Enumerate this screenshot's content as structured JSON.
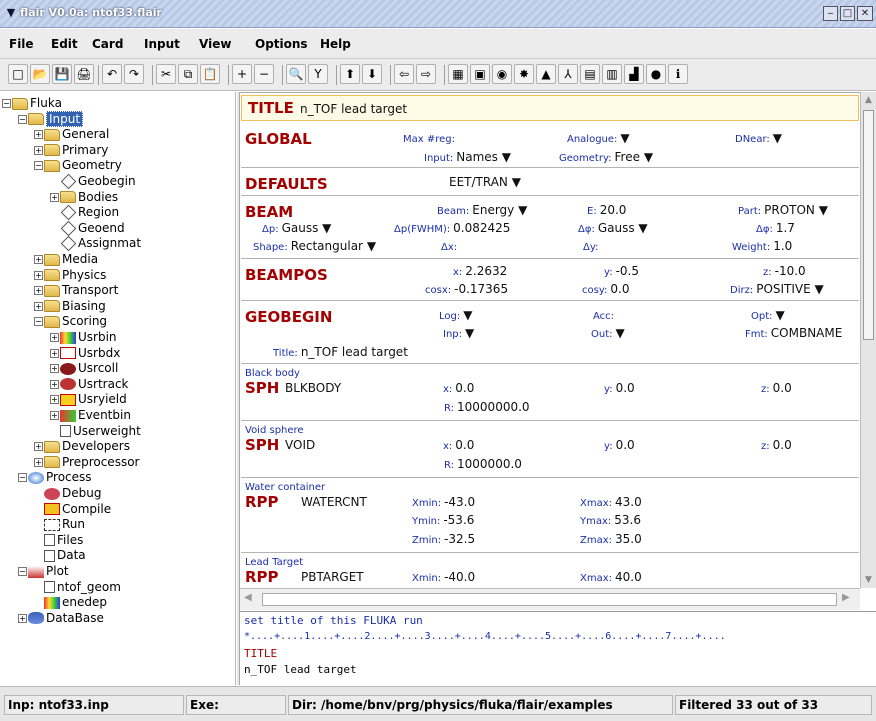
{
  "window": {
    "title": "flair V0.0a: ntof33.flair",
    "controls": [
      "minimize-icon",
      "maximize-icon",
      "close-icon"
    ]
  },
  "menu": [
    "File",
    "Edit",
    "Card",
    "Input",
    "View",
    "Options",
    "Help"
  ],
  "toolbar": {
    "icons": [
      "new-icon",
      "open-icon",
      "save-icon",
      "print-icon",
      "undo-icon",
      "redo-icon",
      "cut-icon",
      "copy-icon",
      "paste-icon",
      "add-icon",
      "remove-icon",
      "find-icon",
      "filter-icon",
      "move-up-icon",
      "move-down-icon",
      "indent-left-icon",
      "indent-right-icon",
      "run-icon",
      "geometry-icon",
      "process-icon",
      "plot-icon",
      "compile-icon",
      "files-icon",
      "data-icon",
      "view-icon",
      "plot2-icon",
      "database-icon",
      "info-icon"
    ],
    "glyphs": [
      "□",
      "📂",
      "💾",
      "🖨",
      "↶",
      "↷",
      "✂",
      "⧉",
      "📋",
      "+",
      "−",
      "🔍",
      "Y",
      "⬆",
      "⬇",
      "⇦",
      "⇨",
      "▦",
      "▣",
      "◉",
      "✸",
      "▲",
      "⅄",
      "▤",
      "▥",
      "▟",
      "●",
      "ℹ"
    ]
  },
  "tree": [
    {
      "label": "Fluka",
      "level": 0,
      "exp": "−",
      "icon": "folder"
    },
    {
      "label": "Input",
      "level": 1,
      "exp": "−",
      "icon": "folder",
      "selected": true
    },
    {
      "label": "General",
      "level": 2,
      "exp": "+",
      "icon": "folder"
    },
    {
      "label": "Primary",
      "level": 2,
      "exp": "+",
      "icon": "folder"
    },
    {
      "label": "Geometry",
      "level": 2,
      "exp": "−",
      "icon": "folder"
    },
    {
      "label": "Geobegin",
      "level": 3,
      "exp": "",
      "icon": "diamond"
    },
    {
      "label": "Bodies",
      "level": 3,
      "exp": "+",
      "icon": "folder"
    },
    {
      "label": "Region",
      "level": 3,
      "exp": "",
      "icon": "diamond"
    },
    {
      "label": "Geoend",
      "level": 3,
      "exp": "",
      "icon": "diamond"
    },
    {
      "label": "Assignmat",
      "level": 3,
      "exp": "",
      "icon": "diamond"
    },
    {
      "label": "Media",
      "level": 2,
      "exp": "+",
      "icon": "folder"
    },
    {
      "label": "Physics",
      "level": 2,
      "exp": "+",
      "icon": "folder"
    },
    {
      "label": "Transport",
      "level": 2,
      "exp": "+",
      "icon": "folder"
    },
    {
      "label": "Biasing",
      "level": 2,
      "exp": "+",
      "icon": "folder"
    },
    {
      "label": "Scoring",
      "level": 2,
      "exp": "−",
      "icon": "folder"
    },
    {
      "label": "Usrbin",
      "level": 3,
      "exp": "+",
      "icon": "usrbin"
    },
    {
      "label": "Usrbdx",
      "level": 3,
      "exp": "+",
      "icon": "usrbdx"
    },
    {
      "label": "Usrcoll",
      "level": 3,
      "exp": "+",
      "icon": "usrcoll"
    },
    {
      "label": "Usrtrack",
      "level": 3,
      "exp": "+",
      "icon": "usrtrack"
    },
    {
      "label": "Usryield",
      "level": 3,
      "exp": "+",
      "icon": "usryield"
    },
    {
      "label": "Eventbin",
      "level": 3,
      "exp": "+",
      "icon": "eventbin"
    },
    {
      "label": "Userweight",
      "level": 3,
      "exp": "",
      "icon": "doc"
    },
    {
      "label": "Developers",
      "level": 2,
      "exp": "+",
      "icon": "folder"
    },
    {
      "label": "Preprocessor",
      "level": 2,
      "exp": "+",
      "icon": "folder"
    },
    {
      "label": "Process",
      "level": 1,
      "exp": "−",
      "icon": "process"
    },
    {
      "label": "Debug",
      "level": 2,
      "exp": "",
      "icon": "debug"
    },
    {
      "label": "Compile",
      "level": 2,
      "exp": "",
      "icon": "compile"
    },
    {
      "label": "Run",
      "level": 2,
      "exp": "",
      "icon": "run"
    },
    {
      "label": "Files",
      "level": 2,
      "exp": "",
      "icon": "doc"
    },
    {
      "label": "Data",
      "level": 2,
      "exp": "",
      "icon": "doc"
    },
    {
      "label": "Plot",
      "level": 1,
      "exp": "−",
      "icon": "plot"
    },
    {
      "label": "ntof_geom",
      "level": 2,
      "exp": "",
      "icon": "doc"
    },
    {
      "label": "enedep",
      "level": 2,
      "exp": "",
      "icon": "usrbin"
    },
    {
      "label": "DataBase",
      "level": 1,
      "exp": "+",
      "icon": "database"
    }
  ],
  "cards": {
    "title": {
      "name": "TITLE",
      "value": "n_TOF lead target"
    },
    "global": {
      "name": "GLOBAL",
      "maxreg_label": "Max #reg:",
      "analogue_label": "Analogue:",
      "dnear_label": "DNear:",
      "input_label": "Input:",
      "input_value": "Names",
      "geometry_label": "Geometry:",
      "geometry_value": "Free"
    },
    "defaults": {
      "name": "DEFAULTS",
      "value": "EET/TRAN"
    },
    "beam": {
      "name": "BEAM",
      "beam_label": "Beam:",
      "beam_value": "Energy",
      "e_label": "E:",
      "e_value": "20.0",
      "part_label": "Part:",
      "part_value": "PROTON",
      "dp_label": "Δp:",
      "dp_value": "Gauss",
      "dpfwhm_label": "Δp(FWHM):",
      "dpfwhm_value": "0.082425",
      "dphi_label": "Δφ:",
      "dphi_value": "Gauss",
      "dphi2_label": "Δφ:",
      "dphi2_value": "1.7",
      "shape_label": "Shape:",
      "shape_value": "Rectangular",
      "dx_label": "Δx:",
      "dy_label": "Δy:",
      "weight_label": "Weight:",
      "weight_value": "1.0"
    },
    "beampos": {
      "name": "BEAMPOS",
      "x_label": "x:",
      "x_value": "2.2632",
      "y_label": "y:",
      "y_value": "-0.5",
      "z_label": "z:",
      "z_value": "-10.0",
      "cosx_label": "cosx:",
      "cosx_value": "-0.17365",
      "cosy_label": "cosy:",
      "cosy_value": "0.0",
      "dirz_label": "Dirz:",
      "dirz_value": "POSITIVE"
    },
    "geobegin": {
      "name": "GEOBEGIN",
      "log_label": "Log:",
      "acc_label": "Acc:",
      "opt_label": "Opt:",
      "inp_label": "Inp:",
      "out_label": "Out:",
      "fmt_label": "Fmt:",
      "fmt_value": "COMBNAME",
      "title_label": "Title:",
      "title_value": "n_TOF lead target"
    },
    "sph1": {
      "comment": "Black body",
      "name": "SPH",
      "id": "BLKBODY",
      "x_label": "x:",
      "x_value": "0.0",
      "y_label": "y:",
      "y_value": "0.0",
      "z_label": "z:",
      "z_value": "0.0",
      "r_label": "R:",
      "r_value": "10000000.0"
    },
    "sph2": {
      "comment": "Void sphere",
      "name": "SPH",
      "id": "VOID",
      "x_label": "x:",
      "x_value": "0.0",
      "y_label": "y:",
      "y_value": "0.0",
      "z_label": "z:",
      "z_value": "0.0",
      "r_label": "R:",
      "r_value": "1000000.0"
    },
    "rpp1": {
      "comment": "Water container",
      "name": "RPP",
      "id": "WATERCNT",
      "xmin_label": "Xmin:",
      "xmin_value": "-43.0",
      "xmax_label": "Xmax:",
      "xmax_value": "43.0",
      "ymin_label": "Ymin:",
      "ymin_value": "-53.6",
      "ymax_label": "Ymax:",
      "ymax_value": "53.6",
      "zmin_label": "Zmin:",
      "zmin_value": "-32.5",
      "zmax_label": "Zmax:",
      "zmax_value": "35.0"
    },
    "rpp2": {
      "comment": "Lead Target",
      "name": "RPP",
      "id": "PBTARGET",
      "xmin_label": "Xmin:",
      "xmin_value": "-40.0",
      "xmax_label": "Xmax:",
      "xmax_value": "40.0"
    }
  },
  "editor": {
    "line1": "set title of this FLUKA run",
    "line2": "*....+....1....+....2....+....3....+....4....+....5....+....6....+....7....+....",
    "line3": "TITLE",
    "line4": "n_TOF lead target"
  },
  "status": {
    "inp": "Inp: ntof33.inp",
    "exe": "Exe:",
    "dir": "Dir: /home/bnv/prg/physics/fluka/flair/examples",
    "filtered": "Filtered 33 out of 33"
  },
  "colors": {
    "card_name": "#a30000",
    "field_label": "#1b2fa8",
    "selection": "#3462b2"
  }
}
